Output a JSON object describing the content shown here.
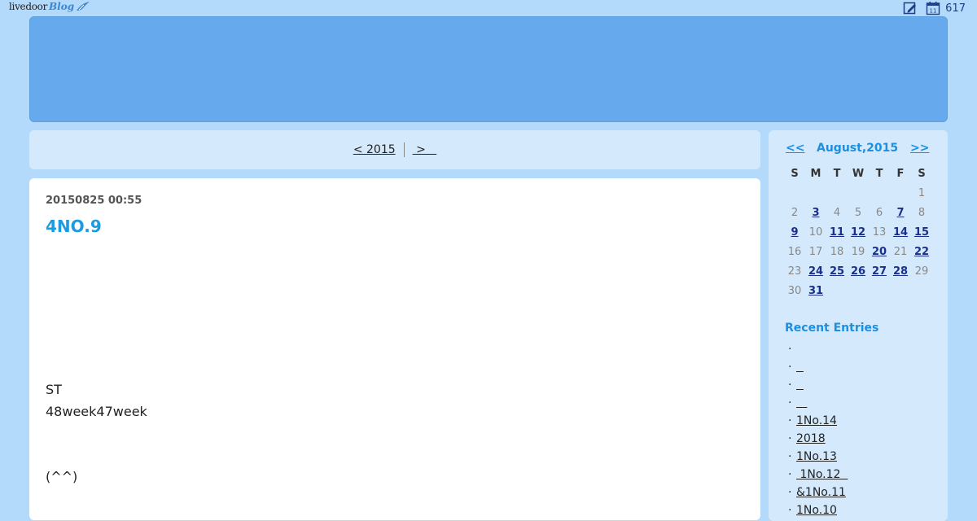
{
  "topbar": {
    "logo_text": "livedoor",
    "logo_blog": "Blog",
    "count": "617"
  },
  "pager": {
    "prev_label": "< 2015",
    "next_label": " >   "
  },
  "article": {
    "date": "20150825 00:55",
    "title": "4NO.9",
    "lines": [
      "ST",
      "48week47week",
      "(^^)"
    ]
  },
  "calendar": {
    "prev": "<<",
    "month": "August,2015",
    "next": ">>",
    "weekdays": [
      "S",
      "M",
      "T",
      "W",
      "T",
      "F",
      "S"
    ],
    "weeks": [
      [
        {
          "d": ""
        },
        {
          "d": ""
        },
        {
          "d": ""
        },
        {
          "d": ""
        },
        {
          "d": ""
        },
        {
          "d": ""
        },
        {
          "d": "1",
          "link": false
        }
      ],
      [
        {
          "d": "2",
          "link": false
        },
        {
          "d": "3",
          "link": true
        },
        {
          "d": "4",
          "link": false
        },
        {
          "d": "5",
          "link": false
        },
        {
          "d": "6",
          "link": false
        },
        {
          "d": "7",
          "link": true
        },
        {
          "d": "8",
          "link": false
        }
      ],
      [
        {
          "d": "9",
          "link": true
        },
        {
          "d": "10",
          "link": false
        },
        {
          "d": "11",
          "link": true
        },
        {
          "d": "12",
          "link": true
        },
        {
          "d": "13",
          "link": false
        },
        {
          "d": "14",
          "link": true
        },
        {
          "d": "15",
          "link": true
        }
      ],
      [
        {
          "d": "16",
          "link": false
        },
        {
          "d": "17",
          "link": false
        },
        {
          "d": "18",
          "link": false
        },
        {
          "d": "19",
          "link": false
        },
        {
          "d": "20",
          "link": true
        },
        {
          "d": "21",
          "link": false
        },
        {
          "d": "22",
          "link": true
        }
      ],
      [
        {
          "d": "23",
          "link": false
        },
        {
          "d": "24",
          "link": true
        },
        {
          "d": "25",
          "link": true
        },
        {
          "d": "26",
          "link": true
        },
        {
          "d": "27",
          "link": true
        },
        {
          "d": "28",
          "link": true
        },
        {
          "d": "29",
          "link": false
        }
      ],
      [
        {
          "d": "30",
          "link": false
        },
        {
          "d": "31",
          "link": true
        },
        {
          "d": ""
        },
        {
          "d": ""
        },
        {
          "d": ""
        },
        {
          "d": ""
        },
        {
          "d": ""
        }
      ]
    ]
  },
  "recent": {
    "title": "Recent Entries",
    "items": [
      "",
      "  ",
      "  ",
      "   ",
      "1No.14",
      "2018",
      "1No.13",
      " 1No.12  ",
      "&1No.11",
      "1No.10"
    ]
  }
}
